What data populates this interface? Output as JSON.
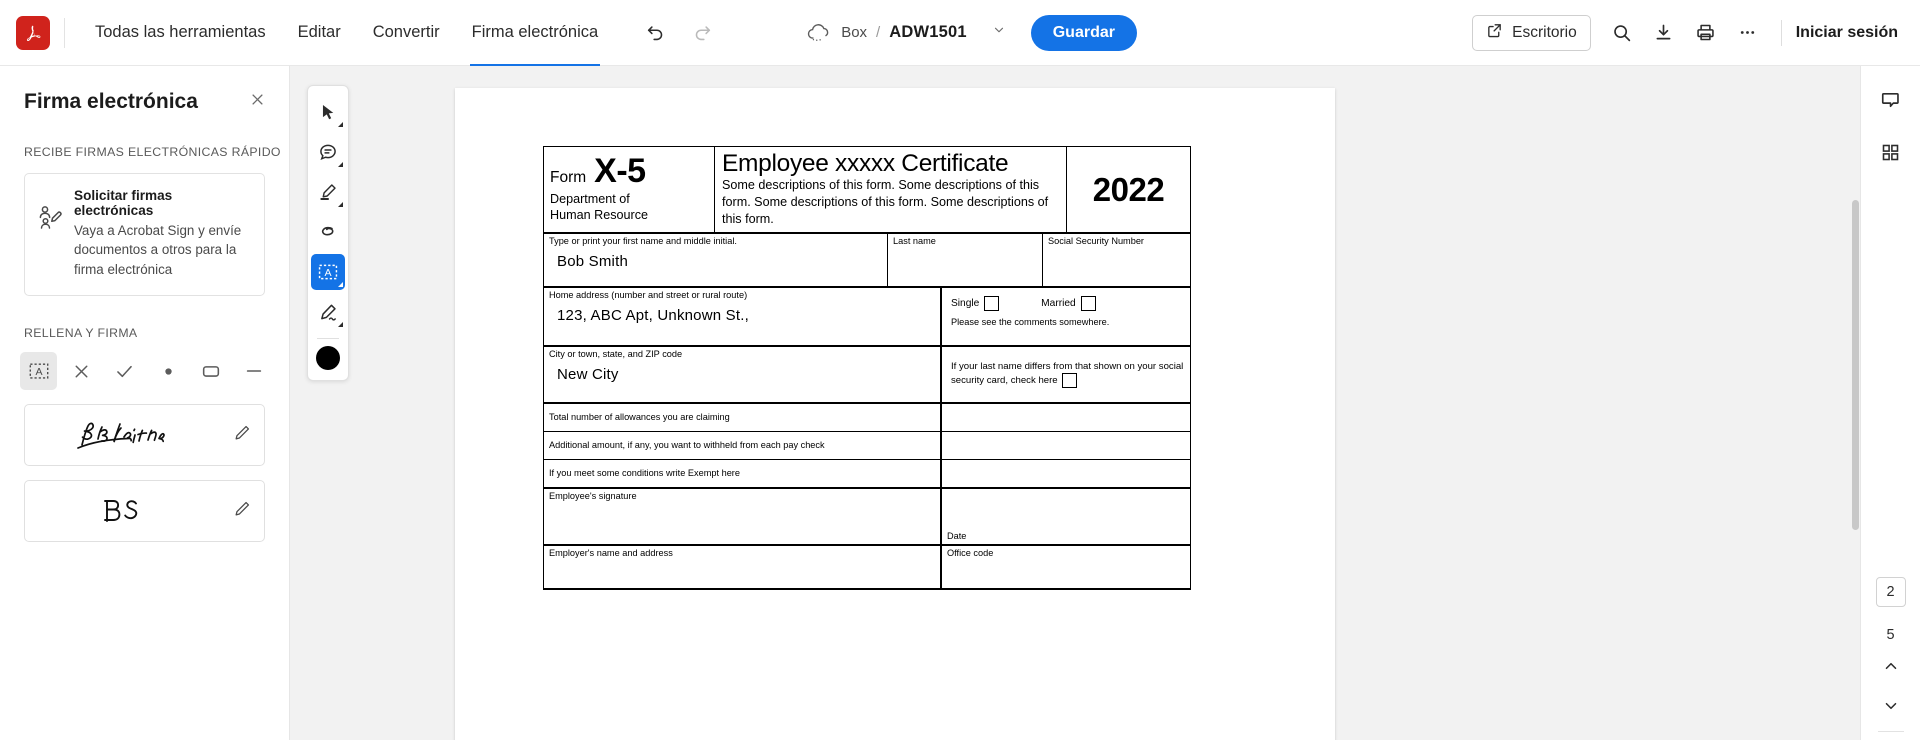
{
  "header": {
    "logo": "adobe-acrobat-logo",
    "menu": [
      {
        "label": "Todas las herramientas",
        "active": false
      },
      {
        "label": "Editar",
        "active": false
      },
      {
        "label": "Convertir",
        "active": false
      },
      {
        "label": "Firma electrónica",
        "active": true
      }
    ],
    "undo_icon": "undo-icon",
    "redo_icon": "redo-icon",
    "file": {
      "storage_icon": "cloud-icon",
      "source": "Box",
      "separator": "/",
      "name": "ADW1501",
      "dropdown_icon": "chevron-down-icon"
    },
    "save_label": "Guardar",
    "save_color": "#1473e6",
    "desktop_label": "Escritorio",
    "desktop_icon": "external-link-icon",
    "search_icon": "search-icon",
    "download_icon": "download-icon",
    "print_icon": "print-icon",
    "more_icon": "more-options-icon",
    "signin_label": "Iniciar sesión"
  },
  "left_panel": {
    "title": "Firma electrónica",
    "close_icon": "close-icon",
    "section_esign": "RECIBE FIRMAS ELECTRÓNICAS RÁPIDO",
    "promo": {
      "icon": "request-signatures-icon",
      "title": "Solicitar firmas electrónicas",
      "description": "Vaya a Acrobat Sign y envíe documentos a otros para la firma electrónica"
    },
    "section_fill": "RELLENA Y FIRMA",
    "tools": [
      {
        "name": "text-field-tool",
        "glyph": "A",
        "selected": true
      },
      {
        "name": "cross-mark-tool",
        "glyph": "✕",
        "selected": false
      },
      {
        "name": "check-mark-tool",
        "glyph": "✓",
        "selected": false
      },
      {
        "name": "dot-tool",
        "glyph": "●",
        "selected": false
      },
      {
        "name": "rounded-rect-tool",
        "glyph": "▢",
        "selected": false
      },
      {
        "name": "line-tool",
        "glyph": "—",
        "selected": false
      }
    ],
    "signatures": [
      {
        "name": "signature-bob-smith",
        "text": "Bob Smith",
        "edit_icon": "pencil-icon"
      },
      {
        "name": "initials-bs",
        "text": "BS",
        "edit_icon": "pencil-icon"
      }
    ]
  },
  "vertical_toolbar": {
    "items": [
      {
        "name": "select-tool",
        "icon": "cursor-icon",
        "selected": false,
        "has_menu": true
      },
      {
        "name": "comment-tool",
        "icon": "comment-icon",
        "selected": false,
        "has_menu": true
      },
      {
        "name": "highlight-tool",
        "icon": "highlighter-icon",
        "selected": false,
        "has_menu": true
      },
      {
        "name": "erase-tool",
        "icon": "lasso-icon",
        "selected": false,
        "has_menu": false
      },
      {
        "name": "add-text-tool",
        "icon": "text-field-icon",
        "selected": true,
        "has_menu": true
      },
      {
        "name": "sign-tool",
        "icon": "sign-pen-icon",
        "selected": false,
        "has_menu": true
      }
    ],
    "color_swatch": "#000000"
  },
  "document": {
    "form": {
      "form_label": "Form",
      "form_number": "X-5",
      "department": "Department of\nHuman Resource",
      "title": "Employee xxxxx Certificate",
      "description": "Some descriptions of this form. Some descriptions of this form. Some descriptions of this form. Some descriptions of this form.",
      "year": "2022",
      "rows": {
        "first_name_label": "Type or print your first name and middle initial.",
        "first_name_value": "Bob Smith",
        "last_name_label": "Last name",
        "last_name_value": "",
        "ssn_label": "Social Security Number",
        "ssn_value": "",
        "address_label": "Home address (number and street or rural route)",
        "address_value": "123, ABC Apt, Unknown St.,",
        "single_label": "Single",
        "married_label": "Married",
        "comments_note": "Please see the comments somewhere.",
        "city_label": "City or town, state, and ZIP code",
        "city_value": "New City",
        "lastname_differs_note": "If your last name differs from that shown on your social security card, check here",
        "allowances_label": "Total number of allowances you are claiming",
        "allowances_value": "",
        "additional_label": "Additional amount, if any, you want to withheld from each pay check",
        "additional_value": "",
        "exempt_label": "If you meet some conditions write Exempt here",
        "exempt_value": "",
        "employee_signature_label": "Employee's signature",
        "date_label": "Date",
        "employer_label": "Employer's name and address",
        "office_code_label": "Office code"
      }
    }
  },
  "right_rail": {
    "comment_icon": "comment-icon",
    "thumbnails_icon": "page-thumbnails-icon",
    "current_page": "2",
    "total_pages": "5",
    "prev_icon": "chevron-up-icon",
    "next_icon": "chevron-down-icon"
  }
}
